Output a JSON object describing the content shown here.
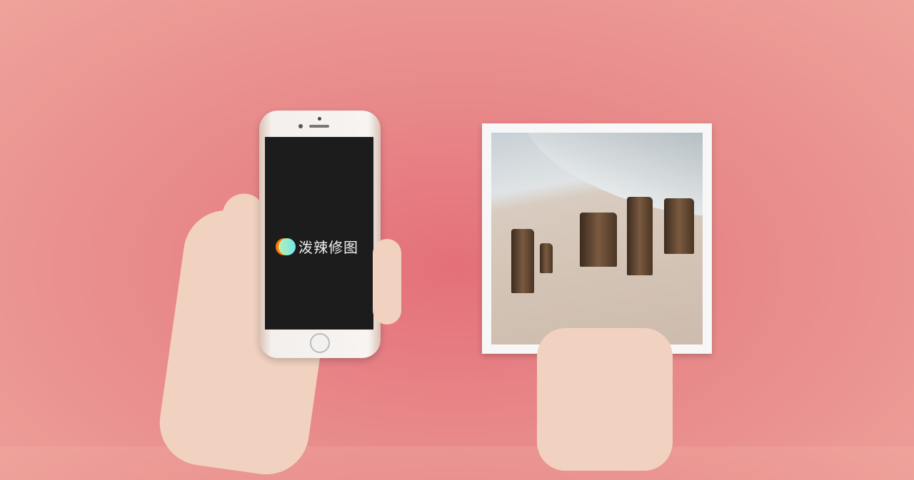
{
  "phone": {
    "app_name": "泼辣修图",
    "logo_colors": [
      "#ff7a00",
      "#6fe8ef"
    ],
    "screen_color": "#1c1c1c"
  },
  "background_color": "#e8898a"
}
